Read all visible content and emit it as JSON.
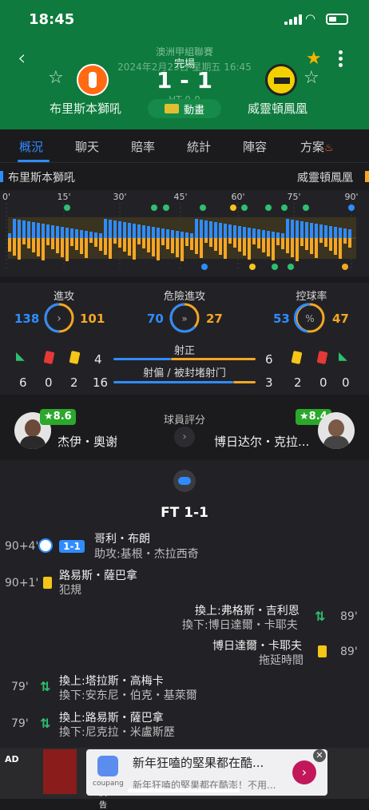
{
  "status_bar": {
    "time": "18:45"
  },
  "header": {
    "league": "澳洲甲組聯賽",
    "match_status": "完場",
    "date": "2024年2月23日 星期五 16:45",
    "score": "1 - 1",
    "half_time": "HT 0-0",
    "animation_label": "動畫",
    "home_team": "布里斯本獅吼",
    "away_team": "威靈頓鳳凰"
  },
  "tabs": [
    "概況",
    "聊天",
    "賠率",
    "統計",
    "陣容",
    "方案"
  ],
  "active_tab": "概況",
  "team_row": {
    "home": "布里斯本獅吼",
    "away": "威靈頓鳳凰"
  },
  "timeline": {
    "ticks": [
      "0'",
      "15'",
      "30'",
      "45'",
      "60'",
      "75'",
      "90'"
    ]
  },
  "stats": {
    "attack": {
      "label": "進攻",
      "home": "138",
      "away": "101"
    },
    "dangerous": {
      "label": "危險進攻",
      "home": "70",
      "away": "27"
    },
    "possession": {
      "label": "控球率",
      "home": "53",
      "away": "47"
    },
    "home_corners": "6",
    "home_red": "0",
    "home_yellow": "2",
    "away_corners": "0",
    "away_red": "0",
    "away_yellow": "2",
    "shots_on": {
      "label": "射正",
      "home": "4",
      "away": "6"
    },
    "shots_off": {
      "label": "射偏 / 被封堵射门",
      "home": "16",
      "away": "3"
    }
  },
  "rating": {
    "title": "球員評分",
    "home_player": "杰伊・奧谢",
    "home_score": "★8.6",
    "away_player": "博日达尔・克拉...",
    "away_score": "★8.4"
  },
  "events": {
    "ft": "FT 1-1",
    "e1": {
      "min": "90+4'",
      "tag": "1-1",
      "line1": "哥利・布朗",
      "line2": "助攻:基根・杰拉西奇"
    },
    "e2": {
      "min": "90+1'",
      "line1": "路易斯・薩巴拿",
      "line2": "犯規"
    },
    "e3": {
      "min": "89'",
      "line1": "換上:弗格斯・吉利恩",
      "line2": "換下:博日達爾・卡耶夫"
    },
    "e4": {
      "min": "89'",
      "line1": "博日達爾・卡耶夫",
      "line2": "拖延時間"
    },
    "e5": {
      "min": "79'",
      "line1": "換上:塔拉斯・高梅卡",
      "line2": "換下:安东尼・伯克・基萊爾"
    },
    "e6": {
      "min": "79'",
      "line1": "換上:路易斯・薩巴拿",
      "line2": "換下:尼克拉・米盧斯歷"
    }
  },
  "ad": {
    "label": "AD",
    "title": "新年狂嗑的堅果都在酷...",
    "sub": "新年狂嗑的堅果都在酷澎！不用...",
    "brand": "coupang",
    "caption": "廣告"
  },
  "colors": {
    "home": "#2f8cff",
    "away": "#f5a623",
    "header": "#0e7a3d"
  }
}
